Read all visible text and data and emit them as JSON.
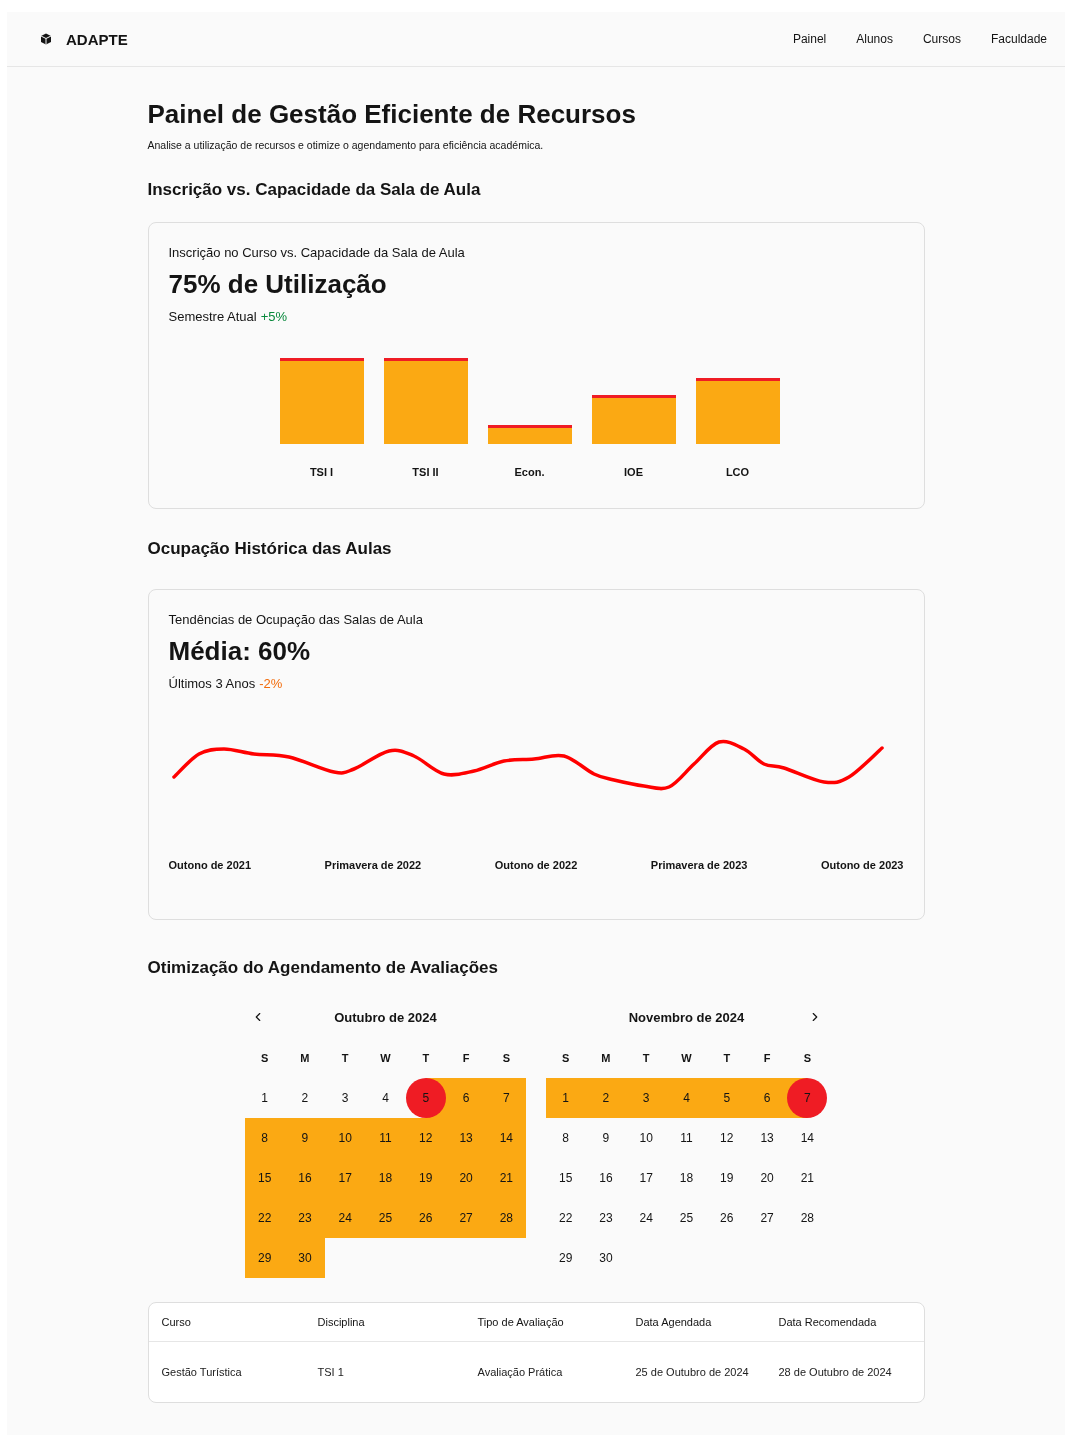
{
  "header": {
    "brand": "ADAPTE",
    "nav": [
      {
        "label": "Painel"
      },
      {
        "label": "Alunos"
      },
      {
        "label": "Cursos"
      },
      {
        "label": "Faculdade"
      }
    ]
  },
  "page": {
    "title": "Painel de Gestão Eficiente de Recursos",
    "subtitle": "Analise a utilização de recursos e otimize o agendamento para eficiência académica."
  },
  "enrollment": {
    "heading": "Inscrição vs. Capacidade da Sala de Aula",
    "card_title": "Inscrição no Curso vs. Capacidade da Sala de Aula",
    "metric": "75% de Utilização",
    "period": "Semestre Atual",
    "change": {
      "text": "+5%",
      "color": "#07883b"
    },
    "bar_labels": [
      "TSI I",
      "TSI II",
      "Econ.",
      "IOE",
      "LCO"
    ]
  },
  "occupancy": {
    "heading": "Ocupação Histórica das Aulas",
    "card_title": "Tendências de Ocupação das Salas de Aula",
    "metric": "Média: 60%",
    "period": "Últimos 3 Anos",
    "change": {
      "text": "-2%",
      "color": "#f26c0c"
    },
    "x_labels": [
      "Outono de 2021",
      "Primavera de 2022",
      "Outono de 2022",
      "Primavera de 2023",
      "Outono de 2023"
    ]
  },
  "scheduling": {
    "heading": "Otimização do Agendamento de Avaliações",
    "months": [
      {
        "title": "Outubro de 2024",
        "weekdays": [
          "S",
          "M",
          "T",
          "W",
          "T",
          "F",
          "S"
        ],
        "days": [
          {
            "day": "1",
            "highlighted": false,
            "selected": false
          },
          {
            "day": "2",
            "highlighted": false,
            "selected": false
          },
          {
            "day": "3",
            "highlighted": false,
            "selected": false
          },
          {
            "day": "4",
            "highlighted": false,
            "selected": false
          },
          {
            "day": "5",
            "highlighted": true,
            "selected": true
          },
          {
            "day": "6",
            "highlighted": true,
            "selected": false
          },
          {
            "day": "7",
            "highlighted": true,
            "selected": false
          },
          {
            "day": "8",
            "highlighted": true,
            "selected": false
          },
          {
            "day": "9",
            "highlighted": true,
            "selected": false
          },
          {
            "day": "10",
            "highlighted": true,
            "selected": false
          },
          {
            "day": "11",
            "highlighted": true,
            "selected": false
          },
          {
            "day": "12",
            "highlighted": true,
            "selected": false
          },
          {
            "day": "13",
            "highlighted": true,
            "selected": false
          },
          {
            "day": "14",
            "highlighted": true,
            "selected": false
          },
          {
            "day": "15",
            "highlighted": true,
            "selected": false
          },
          {
            "day": "16",
            "highlighted": true,
            "selected": false
          },
          {
            "day": "17",
            "highlighted": true,
            "selected": false
          },
          {
            "day": "18",
            "highlighted": true,
            "selected": false
          },
          {
            "day": "19",
            "highlighted": true,
            "selected": false
          },
          {
            "day": "20",
            "highlighted": true,
            "selected": false
          },
          {
            "day": "21",
            "highlighted": true,
            "selected": false
          },
          {
            "day": "22",
            "highlighted": true,
            "selected": false
          },
          {
            "day": "23",
            "highlighted": true,
            "selected": false
          },
          {
            "day": "24",
            "highlighted": true,
            "selected": false
          },
          {
            "day": "25",
            "highlighted": true,
            "selected": false
          },
          {
            "day": "26",
            "highlighted": true,
            "selected": false
          },
          {
            "day": "27",
            "highlighted": true,
            "selected": false
          },
          {
            "day": "28",
            "highlighted": true,
            "selected": false
          },
          {
            "day": "29",
            "highlighted": true,
            "selected": false
          },
          {
            "day": "30",
            "highlighted": true,
            "selected": false
          }
        ]
      },
      {
        "title": "Novembro de 2024",
        "weekdays": [
          "S",
          "M",
          "T",
          "W",
          "T",
          "F",
          "S"
        ],
        "days": [
          {
            "day": "1",
            "highlighted": true,
            "selected": false
          },
          {
            "day": "2",
            "highlighted": true,
            "selected": false
          },
          {
            "day": "3",
            "highlighted": true,
            "selected": false
          },
          {
            "day": "4",
            "highlighted": true,
            "selected": false
          },
          {
            "day": "5",
            "highlighted": true,
            "selected": false
          },
          {
            "day": "6",
            "highlighted": true,
            "selected": false
          },
          {
            "day": "7",
            "highlighted": true,
            "selected": true
          },
          {
            "day": "8",
            "highlighted": false,
            "selected": false
          },
          {
            "day": "9",
            "highlighted": false,
            "selected": false
          },
          {
            "day": "10",
            "highlighted": false,
            "selected": false
          },
          {
            "day": "11",
            "highlighted": false,
            "selected": false
          },
          {
            "day": "12",
            "highlighted": false,
            "selected": false
          },
          {
            "day": "13",
            "highlighted": false,
            "selected": false
          },
          {
            "day": "14",
            "highlighted": false,
            "selected": false
          },
          {
            "day": "15",
            "highlighted": false,
            "selected": false
          },
          {
            "day": "16",
            "highlighted": false,
            "selected": false
          },
          {
            "day": "17",
            "highlighted": false,
            "selected": false
          },
          {
            "day": "18",
            "highlighted": false,
            "selected": false
          },
          {
            "day": "19",
            "highlighted": false,
            "selected": false
          },
          {
            "day": "20",
            "highlighted": false,
            "selected": false
          },
          {
            "day": "21",
            "highlighted": false,
            "selected": false
          },
          {
            "day": "22",
            "highlighted": false,
            "selected": false
          },
          {
            "day": "23",
            "highlighted": false,
            "selected": false
          },
          {
            "day": "24",
            "highlighted": false,
            "selected": false
          },
          {
            "day": "25",
            "highlighted": false,
            "selected": false
          },
          {
            "day": "26",
            "highlighted": false,
            "selected": false
          },
          {
            "day": "27",
            "highlighted": false,
            "selected": false
          },
          {
            "day": "28",
            "highlighted": false,
            "selected": false
          },
          {
            "day": "29",
            "highlighted": false,
            "selected": false
          },
          {
            "day": "30",
            "highlighted": false,
            "selected": false
          }
        ]
      }
    ],
    "table": {
      "columns": [
        "Curso",
        "Disciplina",
        "Tipo de Avaliação",
        "Data Agendada",
        "Data Recomendada"
      ],
      "rows": [
        [
          "Gestão Turística",
          "TSI 1",
          "Avaliação Prática",
          "25 de Outubro de 2024",
          "28 de Outubro de 2024"
        ]
      ]
    }
  }
}
